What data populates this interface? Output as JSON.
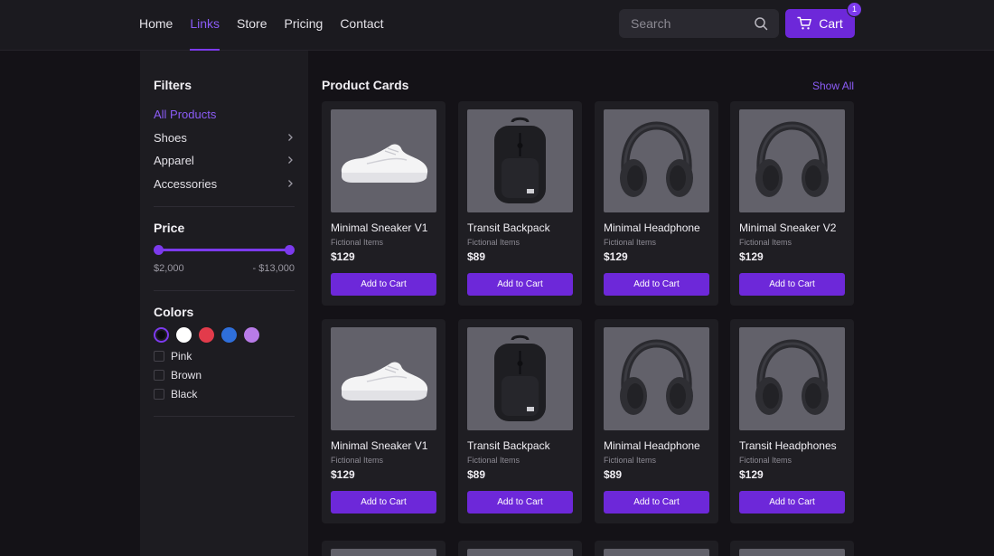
{
  "nav": {
    "links": [
      "Home",
      "Links",
      "Store",
      "Pricing",
      "Contact"
    ],
    "active": "Links"
  },
  "search": {
    "placeholder": "Search"
  },
  "cart": {
    "label": "Cart",
    "count": "1"
  },
  "sidebar": {
    "filters_title": "Filters",
    "categories": [
      "All Products",
      "Shoes",
      "Apparel",
      "Accessories"
    ],
    "price_title": "Price",
    "price_min": "$2,000",
    "price_max": "- $13,000",
    "colors_title": "Colors",
    "swatches": [
      "#0b0b10",
      "#ffffff",
      "#e23b4b",
      "#2f6fdb",
      "#b87be8"
    ],
    "checkboxes": [
      "Pink",
      "Brown",
      "Black"
    ]
  },
  "main": {
    "title": "Product Cards",
    "show_all": "Show All",
    "products": [
      {
        "name": "Minimal Sneaker V1",
        "sub": "Fictional Items",
        "price": "$129",
        "button": "Add to Cart",
        "image": "sneaker-image"
      },
      {
        "name": "Transit Backpack",
        "sub": "Fictional Items",
        "price": "$89",
        "button": "Add to Cart",
        "image": "backpack-image"
      },
      {
        "name": "Minimal Headphone",
        "sub": "Fictional Items",
        "price": "$129",
        "button": "Add to Cart",
        "image": "headphone-image"
      },
      {
        "name": "Minimal Sneaker V2",
        "sub": "Fictional Items",
        "price": "$129",
        "button": "Add to Cart",
        "image": "headphone-image"
      },
      {
        "name": "Minimal Sneaker V1",
        "sub": "Fictional Items",
        "price": "$129",
        "button": "Add to Cart",
        "image": "sneaker-image"
      },
      {
        "name": "Transit Backpack",
        "sub": "Fictional Items",
        "price": "$89",
        "button": "Add to Cart",
        "image": "backpack-image"
      },
      {
        "name": "Minimal Headphone",
        "sub": "Fictional Items",
        "price": "$89",
        "button": "Add to Cart",
        "image": "headphone-image"
      },
      {
        "name": "Transit Headphones",
        "sub": "Fictional Items",
        "price": "$129",
        "button": "Add to Cart",
        "image": "headphone-image"
      }
    ]
  },
  "colors": {
    "accent": "#6d28d9",
    "accent_text": "#8b5cf6",
    "background": "#141217",
    "card": "#1f1e23"
  }
}
